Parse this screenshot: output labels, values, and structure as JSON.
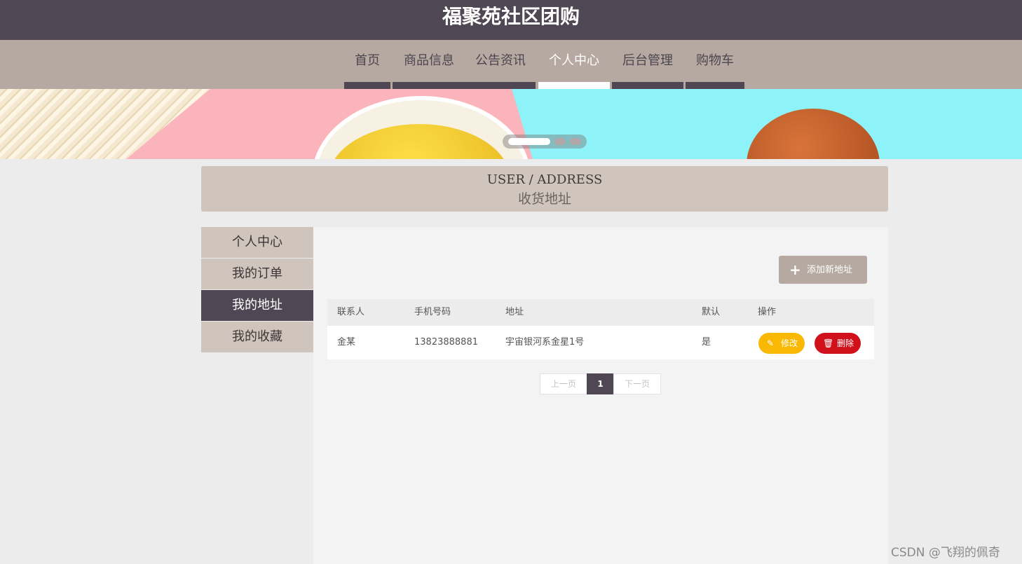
{
  "header": {
    "title": "福聚苑社区团购"
  },
  "nav": {
    "items": [
      {
        "label": "首页"
      },
      {
        "label": "商品信息"
      },
      {
        "label": "公告资讯"
      },
      {
        "label": "个人中心"
      },
      {
        "label": "后台管理"
      },
      {
        "label": "购物车"
      }
    ],
    "active": "个人中心"
  },
  "banner": {
    "active_slide": 1,
    "slide_count": 3
  },
  "page_title": {
    "en": "USER / ADDRESS",
    "cn": "收货地址"
  },
  "sidebar": {
    "items": [
      {
        "label": "个人中心"
      },
      {
        "label": "我的订单"
      },
      {
        "label": "我的地址"
      },
      {
        "label": "我的收藏"
      }
    ],
    "active": "我的地址"
  },
  "toolbar": {
    "add_label": "添加新地址",
    "add_icon": "plus-icon"
  },
  "table": {
    "headers": [
      "联系人",
      "手机号码",
      "地址",
      "默认",
      "操作"
    ],
    "rows": [
      {
        "contact": "金某",
        "phone": "13823888881",
        "address": "宇宙银河系金星1号",
        "default": "是",
        "edit_label": "修改",
        "delete_label": "删除"
      }
    ]
  },
  "pagination": {
    "prev": "上一页",
    "current": "1",
    "next": "下一页"
  },
  "watermark": "CSDN @飞翔的佩奇",
  "colors": {
    "primary": "#4f4854",
    "accent": "#b6a9a1",
    "panel": "#d0c5bc",
    "edit": "#f9b803",
    "delete": "#d0111b"
  }
}
